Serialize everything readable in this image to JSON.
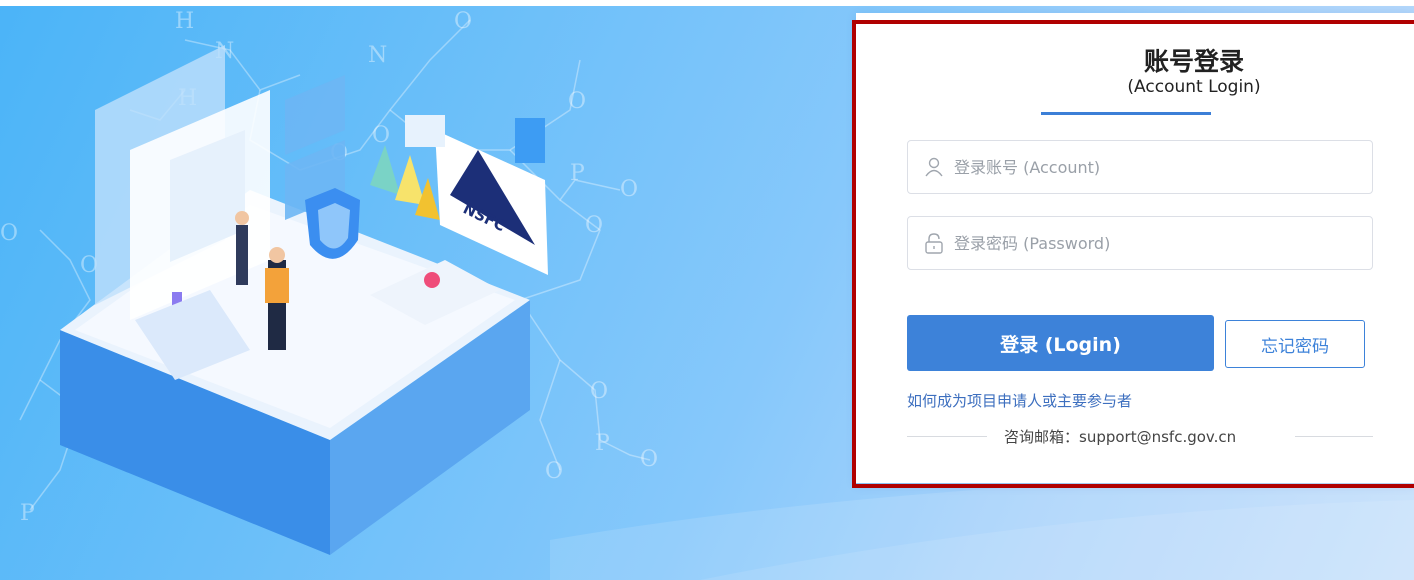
{
  "login": {
    "title": "账号登录",
    "subtitle": "(Account Login)",
    "account_placeholder": "登录账号 (Account)",
    "password_placeholder": "登录密码 (Password)",
    "login_button": "登录 (Login)",
    "forgot_button": "忘记密码",
    "help_link": "如何成为项目申请人或主要参与者",
    "contact_label": "咨询邮箱：support@nsfc.gov.cn"
  },
  "illustration": {
    "logo_text": "NSFC",
    "chem_labels": [
      "H",
      "N",
      "N",
      "H",
      "O",
      "O",
      "P",
      "O",
      "O",
      "O",
      "P",
      "O",
      "O",
      "O",
      "P",
      "O",
      "O",
      "O"
    ]
  },
  "colors": {
    "primary": "#3d82d9",
    "highlight_frame": "#b00000",
    "background_start": "#4bb4f8",
    "background_end": "#c5dffb"
  }
}
